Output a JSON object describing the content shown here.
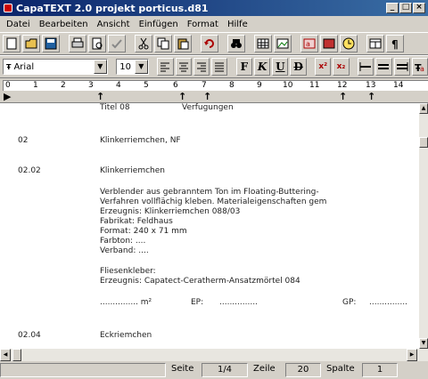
{
  "window": {
    "title": "CapaTEXT 2.0 projekt porticus.d81"
  },
  "window_buttons": {
    "minimize": "_",
    "maximize": "□",
    "close": "×"
  },
  "menu": [
    "Datei",
    "Bearbeiten",
    "Ansicht",
    "Einfügen",
    "Format",
    "Hilfe"
  ],
  "toolbar": {
    "font_name": "Arial",
    "font_size": "10",
    "bold": "F",
    "italic": "K",
    "underline": "U",
    "strike": "D",
    "superscript": "x²",
    "subscript": "x₂"
  },
  "ruler": {
    "numbers": [
      "0",
      "1",
      "2",
      "3",
      "4",
      "5",
      "6",
      "7",
      "8",
      "9",
      "10",
      "11",
      "12",
      "13",
      "14"
    ]
  },
  "document": {
    "header_col1": "Titel 08",
    "header_col2": "Verfugungen",
    "item1_number": "02",
    "item1_title": "Klinkerriemchen, NF",
    "item2_number": "02.02",
    "item2_title": "Klinkerriemchen",
    "desc_line1": "Verblender aus gebranntem Ton im Floating-Buttering-",
    "desc_line2": "Verfahren vollflächig kleben. Materialeigenschaften gem",
    "desc_line3": "Erzeugnis: Klinkerriemchen 088/03",
    "desc_line4": "Fabrikat: Feldhaus",
    "desc_line5": "Format: 240 x 71 mm",
    "desc_line6": "Farbton: ....",
    "desc_line7": "Verband: ....",
    "desc_line8": "Fliesenkleber:",
    "desc_line9": "Erzeugnis: Capatect-Ceratherm-Ansatzmörtel 084",
    "qty_line": "............... m²",
    "ep_label": "EP:",
    "ep_value": "...............",
    "gp_label": "GP:",
    "gp_value": "...............",
    "item3_number": "02.04",
    "item3_title": "Eckriemchen"
  },
  "status": {
    "page_label": "Seite",
    "page_value": "1/4",
    "line_label": "Zeile",
    "line_value": "20",
    "col_label": "Spalte",
    "col_value": "1"
  }
}
